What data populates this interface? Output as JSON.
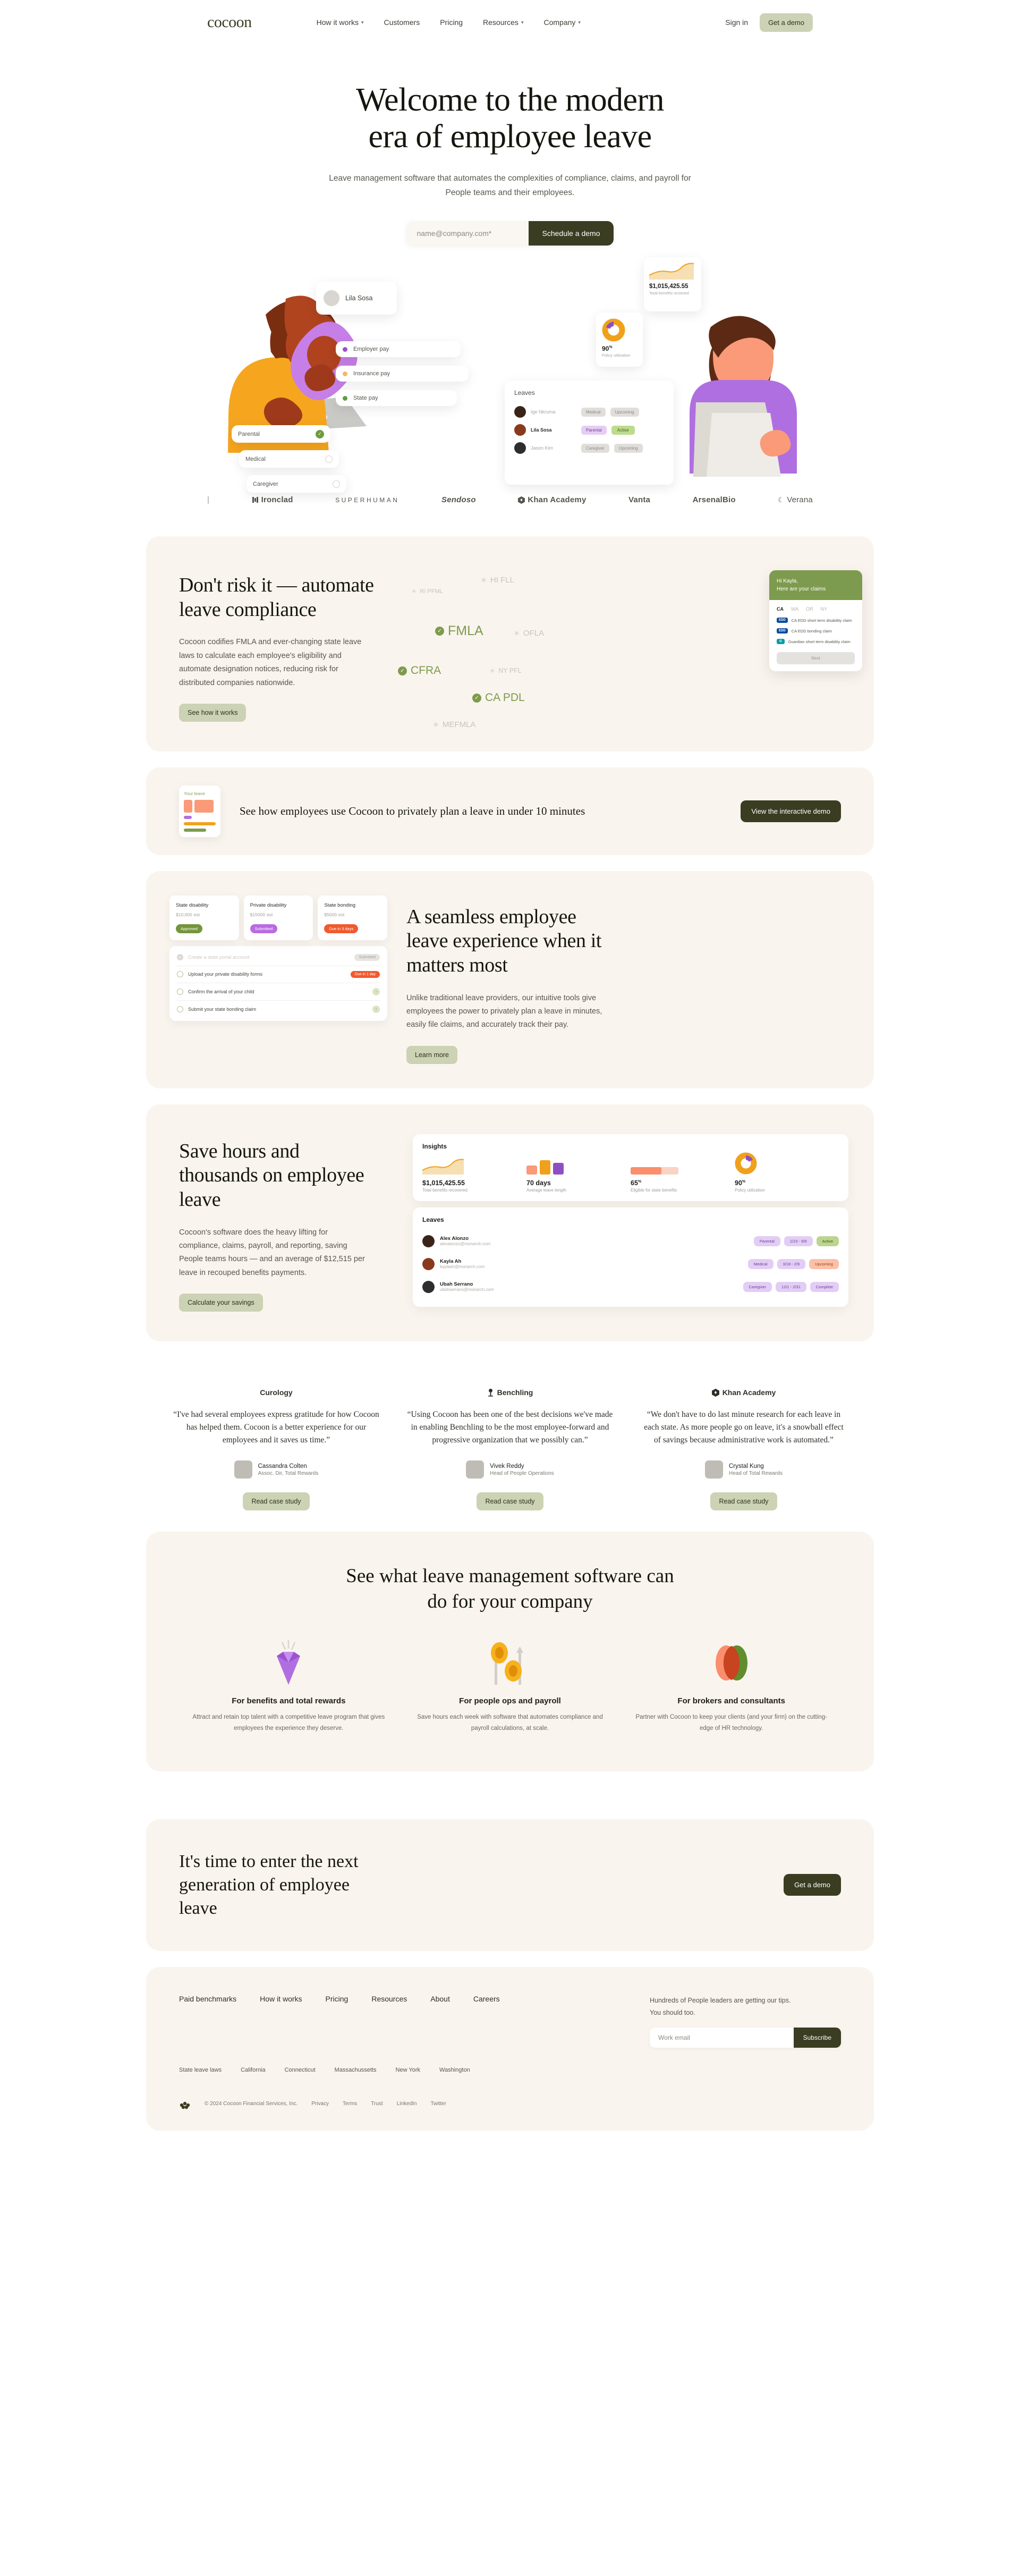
{
  "nav": {
    "logo": "cocoon",
    "links": [
      {
        "label": "How it works",
        "caret": true
      },
      {
        "label": "Customers",
        "caret": false
      },
      {
        "label": "Pricing",
        "caret": false
      },
      {
        "label": "Resources",
        "caret": true
      },
      {
        "label": "Company",
        "caret": true
      }
    ],
    "signin": "Sign in",
    "demo": "Get a demo"
  },
  "hero": {
    "title_line1": "Welcome to the modern",
    "title_line2": "era of employee leave",
    "subtitle": "Leave management software that automates the complexities of compliance, claims, and payroll for People teams and their employees.",
    "email_placeholder": "name@company.com*",
    "cta": "Schedule a demo",
    "art": {
      "person_name": "Lila Sosa",
      "pay_items": [
        {
          "label": "Employer pay",
          "color": "#9b51c9"
        },
        {
          "label": "Insurance pay",
          "color": "#f9b466"
        },
        {
          "label": "State pay",
          "color": "#5f9d3f"
        }
      ],
      "leave_types": [
        {
          "label": "Parental",
          "checked": true
        },
        {
          "label": "Medical",
          "checked": false
        },
        {
          "label": "Caregiver",
          "checked": false
        }
      ],
      "benefits_amount": "$1,015,425.55",
      "benefits_label": "Total benefits recieved",
      "utilization_value": "90",
      "utilization_label": "Policy utilization",
      "leaves_title": "Leaves",
      "leaves": [
        {
          "name": "Ige Nkruma",
          "type": "Medical",
          "status": "Upcoming",
          "active": false
        },
        {
          "name": "Lila Sosa",
          "type": "Parental",
          "status": "Active",
          "active": true
        },
        {
          "name": "Jason Kim",
          "type": "Caregiver",
          "status": "Upcoming",
          "active": false
        }
      ]
    }
  },
  "logos": [
    "|",
    "Ironclad",
    "SUPERHUMAN",
    "Sendoso",
    "Khan Academy",
    "Vanta",
    "ArsenalBio",
    "Verana"
  ],
  "compliance": {
    "title_line1": "Don't risk it — automate",
    "title_line2": "leave compliance",
    "body": "Cocoon codifies FMLA and ever-changing state leave laws to calculate each employee's eligibility and automate designation notices, reducing risk for distributed companies nationwide.",
    "cta": "See how it works",
    "laws": [
      {
        "label": "HI FLL",
        "active": false
      },
      {
        "label": "RI PFML",
        "active": false
      },
      {
        "label": "FMLA",
        "active": true
      },
      {
        "label": "OFLA",
        "active": false
      },
      {
        "label": "CFRA",
        "active": true
      },
      {
        "label": "NY PFL",
        "active": false
      },
      {
        "label": "CA PDL",
        "active": true
      },
      {
        "label": "MEFMLA",
        "active": false
      }
    ],
    "claims_card": {
      "greeting_line1": "Hi Kayla,",
      "greeting_line2": "Here are your claims",
      "tabs": [
        "CA",
        "WA",
        "OR",
        "NY"
      ],
      "active_tab": "CA",
      "rows": [
        {
          "badge": "EDD",
          "badge_type": "edd",
          "text": "CA EDD short term disability claim"
        },
        {
          "badge": "EDD",
          "badge_type": "edd",
          "text": "CA EDD bonding claim"
        },
        {
          "badge": "G",
          "badge_type": "gdn",
          "text": "Guardian short term disability claim"
        }
      ],
      "next": "Next"
    }
  },
  "demo_strip": {
    "thumb_title": "Your leave",
    "text": "See how employees use Cocoon to privately plan a leave in under 10 minutes",
    "cta": "View the interactive demo"
  },
  "seamless": {
    "title_line1": "A seamless employee",
    "title_line2": "leave experience when it",
    "title_line3": "matters most",
    "body": "Unlike traditional leave providers, our intuitive tools give employees the power to privately plan a leave in minutes, easily file claims, and accurately track their pay.",
    "cta": "Learn more",
    "cards": [
      {
        "title": "State disability",
        "value": "$10,000",
        "unit": "est",
        "pill": "Approved",
        "pill_color": "#74953c"
      },
      {
        "title": "Private disability",
        "value": "$15000",
        "unit": "est",
        "pill": "Submitted",
        "pill_color": "#b96be0"
      },
      {
        "title": "State bonding",
        "value": "$5000",
        "unit": "est",
        "pill": "Due in 3 days",
        "pill_color": "#f05a2d"
      }
    ],
    "tasks": [
      {
        "label": "Create a state portal account",
        "done": true,
        "tag": "Submitted",
        "tag_color": "#e6e4e0",
        "tag_text": "#a8a49d"
      },
      {
        "label": "Upload your private disability forms",
        "done": false,
        "tag": "Due in 1 day",
        "tag_color": "#f05a2d",
        "tag_text": "#ffffff"
      },
      {
        "label": "Confirm the arrival of your child",
        "done": false,
        "tag": "",
        "tag_color": "",
        "tag_text": ""
      },
      {
        "label": "Submit your state bonding claim",
        "done": false,
        "tag": "",
        "tag_color": "",
        "tag_text": ""
      }
    ]
  },
  "save": {
    "title_line1": "Save hours and",
    "title_line2": "thousands on employee",
    "title_line3": "leave",
    "body": "Cocoon's software does the heavy lifting for compliance, claims, payroll, and reporting, saving People teams hours — and an average of $12,515 per leave in recouped benefits payments.",
    "cta": "Calculate your savings",
    "insights_title": "Insights",
    "insights": [
      {
        "value": "$1,015,425.55",
        "sup": "",
        "label": "Total benefits recovered",
        "viz": "area"
      },
      {
        "value": "70 days",
        "sup": "",
        "label": "Average leave length",
        "viz": "bars"
      },
      {
        "value": "65",
        "sup": "%",
        "label": "Eligible for state benefits",
        "viz": "progress"
      },
      {
        "value": "90",
        "sup": "%",
        "label": "Policy utilization",
        "viz": "donut"
      }
    ],
    "leaves_title": "Leaves",
    "leaves": [
      {
        "name": "Alex Alonzo",
        "email": "alexalonzo@monaroh.com",
        "type": "Parental",
        "dates": "1/23 - 9/9",
        "status": "Active",
        "status_bg": "#bcd58e",
        "status_fg": "#3d5318"
      },
      {
        "name": "Kayla Ah",
        "email": "kaylaah@monarch.com",
        "type": "Medical",
        "dates": "3/18 - 2/9",
        "status": "Upcoming",
        "status_bg": "#fbc0a6",
        "status_fg": "#9a4222"
      },
      {
        "name": "Ubah Serrano",
        "email": "ubahserrano@monarch.com",
        "type": "Caregiver",
        "dates": "12/1 - 2/31",
        "status": "Complete",
        "status_bg": "#e2cdf5",
        "status_fg": "#6b3f93"
      }
    ]
  },
  "testimonials": [
    {
      "brand": "Curology",
      "brand_icon": "",
      "quote": "“I've had several employees express gratitude for how Cocoon has helped them. Cocoon is a better experience for our employees and it saves us time.”",
      "name": "Cassandra Colten",
      "role": "Assoc. Dir, Total Rewards",
      "cta": "Read case study"
    },
    {
      "brand": "Benchling",
      "brand_icon": "benchling-icon",
      "quote": "“Using Cocoon has been one of the best decisions we've made in enabling Benchling to be the most employee-forward and progressive organization that we possibly can.”",
      "name": "Vivek Reddy",
      "role": "Head of People Operations",
      "cta": "Read case study"
    },
    {
      "brand": "Khan Academy",
      "brand_icon": "khan-icon",
      "quote": "“We don't have to do last minute research for each leave in each state. As more people go on leave, it's a snowball effect of savings because administrative work is automated.”",
      "name": "Crystal Kung",
      "role": "Head of Total Rewards",
      "cta": "Read case study"
    }
  ],
  "what": {
    "title_line1": "See what leave management software can",
    "title_line2": "do for your company",
    "cards": [
      {
        "icon": "gem-icon",
        "title": "For benefits and total rewards",
        "body": "Attract and retain top talent with a competitive leave program that gives employees the experience they deserve."
      },
      {
        "icon": "coins-arrow-icon",
        "title": "For people ops and payroll",
        "body": "Save hours each week with software that automates compliance and payroll calculations, at scale."
      },
      {
        "icon": "venn-icon",
        "title": "For brokers and consultants",
        "body": "Partner with Cocoon to keep your clients (and your firm) on the cutting-edge of HR technology."
      }
    ]
  },
  "cta": {
    "title_line1": "It's time to enter the next",
    "title_line2": "generation of employee",
    "title_line3": "leave",
    "button": "Get a demo"
  },
  "footer": {
    "links": [
      "Paid benchmarks",
      "How it works",
      "Pricing",
      "Resources",
      "About",
      "Careers"
    ],
    "newsletter_line1": "Hundreds of People leaders are getting our tips.",
    "newsletter_line2": "You should too.",
    "email_placeholder": "Work email",
    "subscribe": "Subscribe",
    "states": [
      "State leave laws",
      "California",
      "Connecticut",
      "Massachussetts",
      "New York",
      "Washington"
    ],
    "copyright": "© 2024 Cocoon Financial Services, Inc.",
    "legal": [
      "Privacy",
      "Terms",
      "Trust",
      "LinkedIn",
      "Twitter"
    ]
  }
}
